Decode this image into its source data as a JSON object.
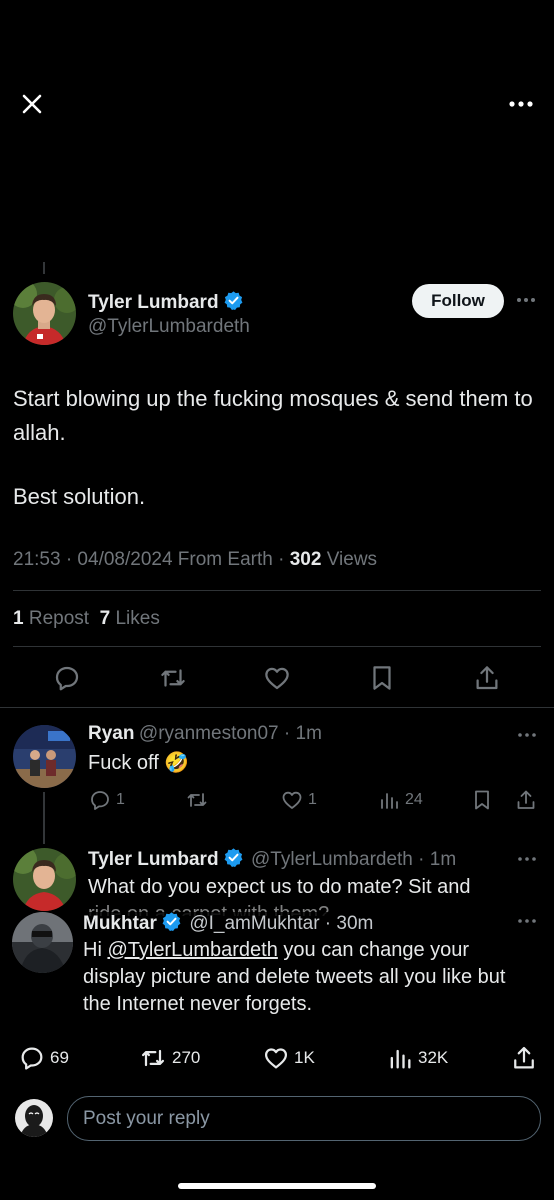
{
  "post": {
    "author_name": "Tyler Lumbard",
    "author_handle": "@TylerLumbardeth",
    "follow_label": "Follow",
    "body_line1": "Start blowing up the fucking mosques & send them to allah.",
    "body_line2": "Best solution.",
    "timestamp": "21:53 · 04/08/2024 From Earth · ",
    "views_count": "302",
    "views_label": " Views",
    "reposts_count": "1",
    "reposts_label": "Repost",
    "likes_count": "7",
    "likes_label": "Likes"
  },
  "reply1": {
    "name": "Ryan",
    "handle_time": "@ryanmeston07 · 1m",
    "text": "Fuck off 🤣",
    "replies": "1",
    "likes": "1",
    "views": "24"
  },
  "reply2": {
    "name": "Tyler Lumbard",
    "handle_time": "@TylerLumbardeth · 1m",
    "text_line1": "What do you expect us to do mate? Sit and",
    "text_line2": "ride on a carpet with them?"
  },
  "overlay": {
    "name": "Mukhtar",
    "handle_time": "@I_amMukhtar · 30m",
    "text_prefix": "Hi ",
    "mention": "@TylerLumbardeth",
    "text_rest": " you can change your display picture and delete tweets all you like but the Internet never forgets.",
    "replies": "69",
    "reposts": "270",
    "likes": "1K",
    "views": "32K"
  },
  "composer": {
    "placeholder": "Post your reply"
  },
  "colors": {
    "verified_blue": "#1d9bf0",
    "background": "#000000",
    "muted": "#71767b"
  }
}
